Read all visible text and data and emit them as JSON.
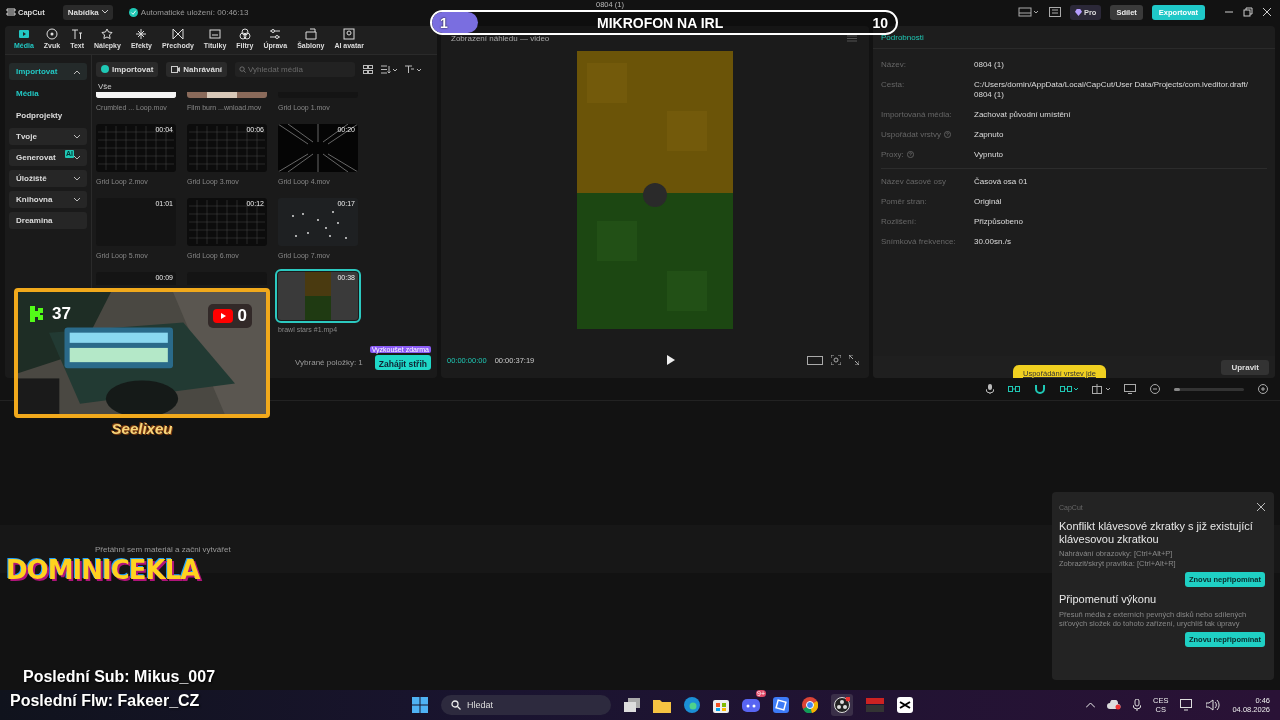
{
  "app": {
    "logo": "CapCut",
    "menu_button": "Nabídka",
    "autosave": "Automatické uložení: 00:46:13",
    "project_title": "0804 (1)",
    "pro": "Pro",
    "share": "Sdílet",
    "export": "Exportovat"
  },
  "tabs": [
    {
      "label": "Média",
      "selected": true
    },
    {
      "label": "Zvuk",
      "selected": false
    },
    {
      "label": "Text",
      "selected": false
    },
    {
      "label": "Nálepky",
      "selected": false
    },
    {
      "label": "Efekty",
      "selected": false
    },
    {
      "label": "Přechody",
      "selected": false
    },
    {
      "label": "Titulky",
      "selected": false
    },
    {
      "label": "Filtry",
      "selected": false
    },
    {
      "label": "Úprava",
      "selected": false
    },
    {
      "label": "Šablony",
      "selected": false
    },
    {
      "label": "AI avatar",
      "selected": false
    }
  ],
  "sidebar": [
    {
      "label": "Importovat",
      "kind": "group",
      "expanded": true,
      "selected": true
    },
    {
      "label": "Média",
      "kind": "link",
      "selected": true
    },
    {
      "label": "Podprojekty",
      "kind": "link",
      "selected": false
    },
    {
      "label": "Tvoje",
      "kind": "group",
      "expanded": false,
      "selected": false
    },
    {
      "label": "Generovat",
      "kind": "group",
      "expanded": false,
      "selected": false,
      "badge": "AI"
    },
    {
      "label": "Úložiště",
      "kind": "group",
      "expanded": false,
      "selected": false
    },
    {
      "label": "Knihovna",
      "kind": "group",
      "expanded": false,
      "selected": false
    },
    {
      "label": "Dreamina",
      "kind": "plain",
      "selected": false
    }
  ],
  "media_toolbar": {
    "import": "Importovat",
    "record": "Nahrávání",
    "search": {
      "placeholder": "Vyhledat média"
    }
  },
  "media": {
    "filter": "Vše",
    "items": [
      {
        "name": "Crumbled ... Loop.mov",
        "kind": "light",
        "selected": false
      },
      {
        "name": "Film burn ...wnload.mov",
        "kind": "burn",
        "selected": false
      },
      {
        "name": "Grid Loop 1.mov",
        "kind": "dark",
        "selected": false
      },
      {
        "name": "Grid Loop 2.mov",
        "duration": "00:04",
        "kind": "grid",
        "selected": false
      },
      {
        "name": "Grid Loop 3.mov",
        "duration": "00:06",
        "kind": "grid",
        "selected": false
      },
      {
        "name": "Grid Loop 4.mov",
        "duration": "00:20",
        "kind": "tunnel",
        "selected": false
      },
      {
        "name": "Grid Loop 5.mov",
        "duration": "01:01",
        "kind": "dark",
        "selected": false
      },
      {
        "name": "Grid Loop 6.mov",
        "duration": "00:12",
        "kind": "grid",
        "selected": false
      },
      {
        "name": "Grid Loop 7.mov",
        "duration": "00:17",
        "kind": "dots",
        "selected": false
      },
      {
        "duration": "00:09",
        "kind": "dark",
        "selected": false
      },
      {
        "kind": "dark",
        "selected": false
      },
      {
        "name": "brawl stars #1.mp4",
        "duration": "00:38",
        "kind": "video",
        "selected": true
      }
    ]
  },
  "media_footer": {
    "selected_count": "Vybrané položky: 1",
    "start_button": "Zahájit střih",
    "start_badge": "Vyzkoušet zdarma"
  },
  "preview": {
    "title": "Zobrazení náhledu — video",
    "current_time": "00:00:00:00",
    "duration": "00:00:37:19"
  },
  "details": {
    "title": "Podrobnosti",
    "groups": [
      [
        {
          "label": "Název:",
          "value": "0804 (1)",
          "help": false
        },
        {
          "label": "Cesta:",
          "value": "C:/Users/domin/AppData/Local/CapCut/User Data/Projects/com.lveditor.draft/ 0804 (1)",
          "help": false
        },
        {
          "label": "Importovaná média:",
          "value": "Zachovat původní umístění",
          "help": false
        },
        {
          "label": "Uspořádat vrstvy",
          "value": "Zapnuto",
          "help": true
        },
        {
          "label": "Proxy:",
          "value": "Vypnuto",
          "help": true
        }
      ],
      [
        {
          "label": "Název časové osy",
          "value": "Časová osa 01",
          "help": false
        },
        {
          "label": "Poměr stran:",
          "value": "Originál",
          "help": false
        },
        {
          "label": "Rozlišení:",
          "value": "Přizpůsobeno",
          "help": false
        },
        {
          "label": "Snímková frekvence:",
          "value": "30.00sn./s",
          "help": false
        }
      ]
    ],
    "edit_button": "Upravit",
    "toast": "Uspořádání vrstev jde"
  },
  "timeline": {
    "zoom": {
      "level": 0.08
    },
    "drop_hint": "Přetáhni sem materiál a začni vytvářet"
  },
  "notification": {
    "app": "CapCut",
    "sections": [
      {
        "title": "Konflikt klávesové zkratky s již existující klávesovou zkratkou",
        "lines": [
          "Nahrávání obrazovky: [Ctrl+Alt+P]",
          "Zobrazit/skrýt pravítka: [Ctrl+Alt+R]"
        ],
        "button": "Znovu nepřipomínat"
      },
      {
        "title": "Připomenutí výkonu",
        "lines": [
          "Přesuň média z externích pevných disků nebo sdílených síťových složek do tohoto zařízení, urychlíš tak úpravy"
        ],
        "button": "Znovu nepřipomínat"
      }
    ]
  },
  "taskbar": {
    "search": {
      "placeholder": "Hledat"
    },
    "chat_badge": "9+",
    "language": "CES",
    "layout": "CS",
    "time": "0:46",
    "date": "04.08.2026"
  },
  "stream_overlay": {
    "goal": {
      "start": "1",
      "title": "MIKROFON NA IRL",
      "end": "10",
      "level": 0.1
    },
    "camera": {
      "kick_count": "37",
      "youtube_count": "0",
      "name": "Seelixeu"
    },
    "channel_name": "DOMINICEKLA",
    "last_sub": "Poslední Sub: Mikus_007",
    "last_follow": "Poslední Flw: Fakeer_CZ"
  }
}
